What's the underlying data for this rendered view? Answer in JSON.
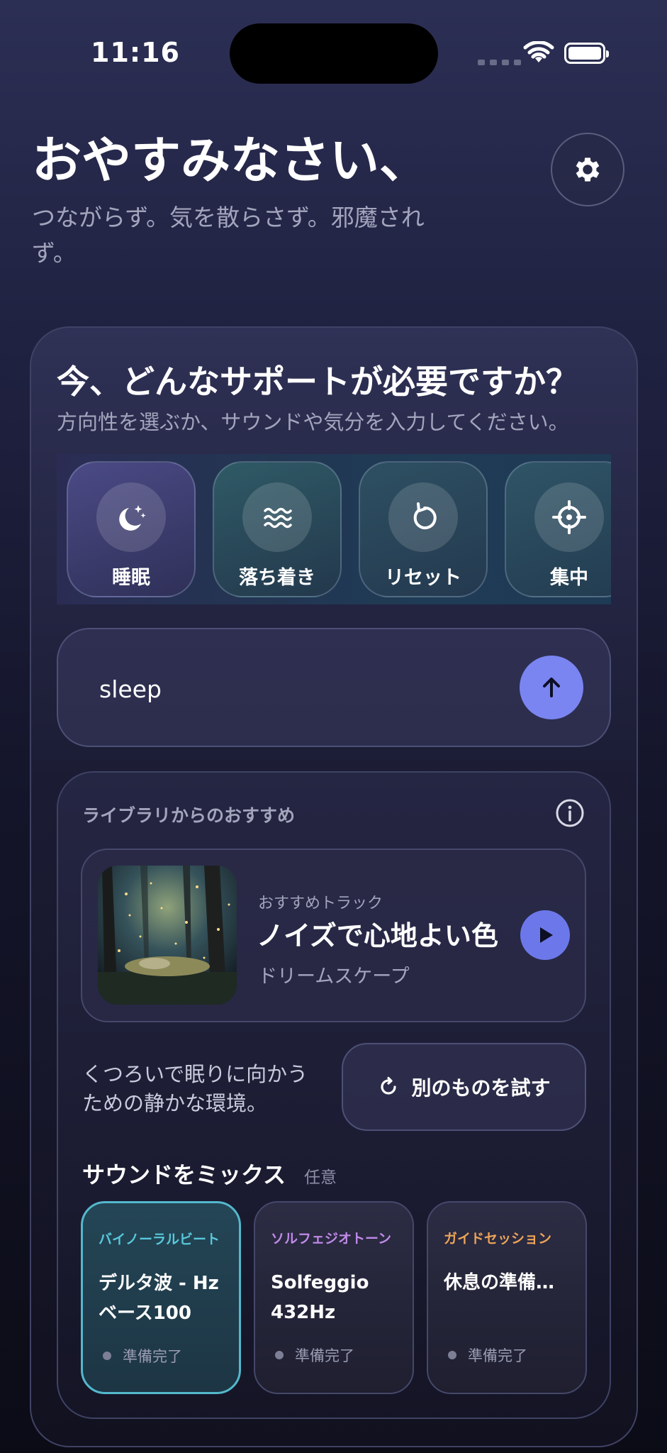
{
  "status_bar": {
    "time": "11:16"
  },
  "header": {
    "greeting": "おやすみなさい、",
    "subtitle": "つながらず。気を散らさず。邪魔されず。"
  },
  "support": {
    "question": "今、どんなサポートが必要ですか？",
    "subtitle": "方向性を選ぶか、サウンドや気分を入力してください。",
    "chips": [
      {
        "label": "睡眠",
        "icon": "moon-stars-icon"
      },
      {
        "label": "落ち着き",
        "icon": "waves-icon"
      },
      {
        "label": "リセット",
        "icon": "reset-arrow-icon"
      },
      {
        "label": "集中",
        "icon": "crosshair-icon"
      }
    ]
  },
  "input": {
    "value": "sleep"
  },
  "recommendation": {
    "title": "ライブラリからのおすすめ",
    "track": {
      "label": "おすすめトラック",
      "title": "ノイズで心地よい色",
      "artist": "ドリームスケープ"
    },
    "description": "くつろいで眠りに向かうための静かな環境。",
    "retry_label": "別のものを試す"
  },
  "mix": {
    "title": "サウンドをミックス",
    "optional": "任意",
    "items": [
      {
        "category": "バイノーラルビート",
        "category_color": "#58c8dc",
        "name": "デルタ波 - Hz ベース100",
        "status": "準備完了",
        "selected": true
      },
      {
        "category": "ソルフェジオトーン",
        "category_color": "#c08ae8",
        "name": "Solfeggio 432Hz",
        "status": "準備完了",
        "selected": false
      },
      {
        "category": "ガイドセッション",
        "category_color": "#eca458",
        "name": "休息の準備…",
        "status": "準備完了",
        "selected": false
      }
    ]
  }
}
